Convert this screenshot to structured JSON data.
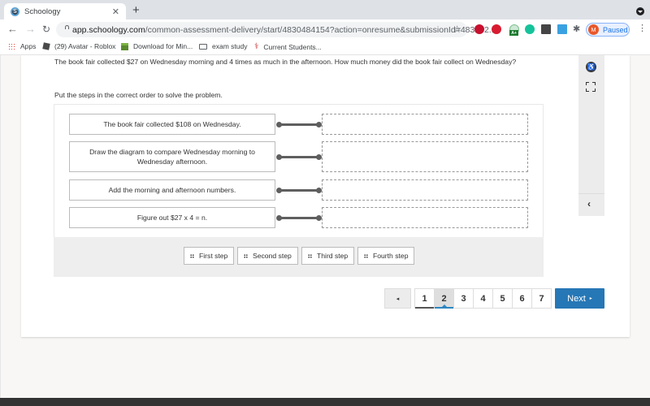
{
  "browser": {
    "tab": {
      "title": "Schoology",
      "favicon": "schoology-icon",
      "close_glyph": "✕"
    },
    "new_tab_glyph": "+",
    "nav": {
      "back_glyph": "←",
      "forward_glyph": "→",
      "reload_glyph": "↻"
    },
    "url_host": "app.schoology.com",
    "url_path": "/common-assessment-delivery/start/4830484154?action=onresume&submissionId=483282...",
    "star_glyph": "☆",
    "extensions": [
      "ext-red-1",
      "ext-red-2",
      "ext-grade-badge",
      "grammarly",
      "ext-dark",
      "ext-blue",
      "extensions-puzzle"
    ],
    "extension_badge": "A+",
    "puzzle_glyph": "✱",
    "profile": {
      "initial": "M",
      "label": "Paused",
      "color": "#e8592b"
    },
    "menu_glyph": "⋮",
    "bookmarks": [
      {
        "label": "Apps",
        "icon": "apps-grid-icon"
      },
      {
        "label": "(29) Avatar - Roblox",
        "icon": "roblox-icon"
      },
      {
        "label": "Download for Min...",
        "icon": "minecraft-icon"
      },
      {
        "label": "exam study",
        "icon": "folder-icon"
      },
      {
        "label": "Current Students...",
        "icon": "students-icon"
      }
    ]
  },
  "question": {
    "prompt": "The book fair collected $27 on Wednesday morning and 4 times as much in the afternoon.  How much money did the book fair collect on Wednesday?",
    "instruction": "Put the steps in the correct order to solve the problem."
  },
  "side_rail": {
    "accessibility_glyph": "♿",
    "collapse_glyph": "‹"
  },
  "ordering": {
    "items": [
      {
        "text": "The book fair collected $108 on Wednesday.",
        "answer": ""
      },
      {
        "text": "Draw the diagram to compare Wednesday morning to Wednesday afternoon.",
        "answer": ""
      },
      {
        "text": "Add the morning and afternoon numbers.",
        "answer": ""
      },
      {
        "text": "Figure out $27 x 4 = n.",
        "answer": ""
      }
    ],
    "choices": [
      "First step",
      "Second step",
      "Third step",
      "Fourth step"
    ]
  },
  "pagination": {
    "prev_glyph": "◂",
    "pages": [
      "1",
      "2",
      "3",
      "4",
      "5",
      "6",
      "7"
    ],
    "current_page": "2",
    "visited_pages": [
      "1"
    ],
    "next_label": "Next",
    "next_glyph": "▸",
    "accent_color": "#2677b5"
  }
}
